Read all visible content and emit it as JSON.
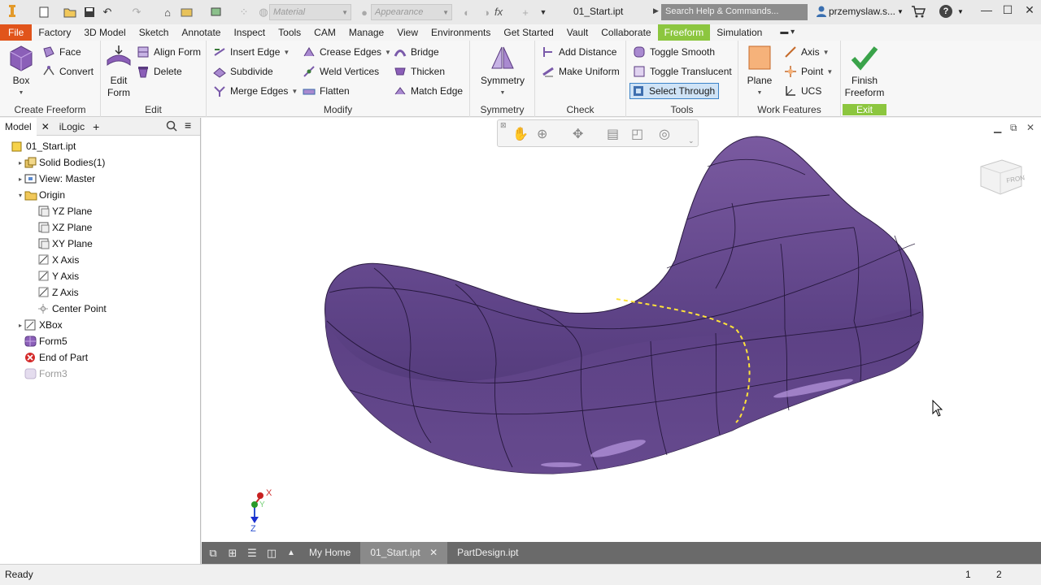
{
  "titlebar": {
    "material_placeholder": "Material",
    "appearance_placeholder": "Appearance",
    "fx_label": "fx",
    "doc_title": "01_Start.ipt",
    "search_placeholder": "Search Help & Commands...",
    "user": "przemyslaw.s..."
  },
  "menu": [
    "File",
    "Factory",
    "3D Model",
    "Sketch",
    "Annotate",
    "Inspect",
    "Tools",
    "CAM",
    "Manage",
    "View",
    "Environments",
    "Get Started",
    "Vault",
    "Collaborate",
    "Freeform",
    "Simulation"
  ],
  "menu_active": "Freeform",
  "ribbon": {
    "create_freeform": {
      "title": "Create Freeform",
      "box": "Box",
      "face": "Face",
      "convert": "Convert"
    },
    "edit": {
      "title": "Edit",
      "edit_form_1": "Edit",
      "edit_form_2": "Form",
      "align_form": "Align Form",
      "delete": "Delete"
    },
    "modify": {
      "title": "Modify",
      "insert_edge": "Insert Edge",
      "subdivide": "Subdivide",
      "merge_edges": "Merge Edges",
      "crease_edges": "Crease Edges",
      "weld_vertices": "Weld Vertices",
      "flatten": "Flatten",
      "bridge": "Bridge",
      "thicken": "Thicken",
      "match_edge": "Match Edge"
    },
    "symmetry": {
      "title": "Symmetry",
      "symmetry": "Symmetry"
    },
    "check": {
      "title": "Check",
      "add_distance": "Add Distance",
      "make_uniform": "Make Uniform"
    },
    "tools": {
      "title": "Tools",
      "toggle_smooth": "Toggle Smooth",
      "toggle_translucent": "Toggle Translucent",
      "select_through": "Select Through"
    },
    "work_features": {
      "title": "Work Features",
      "plane": "Plane",
      "axis": "Axis",
      "point": "Point",
      "ucs": "UCS"
    },
    "exit": {
      "title": "Exit",
      "finish_1": "Finish",
      "finish_2": "Freeform"
    }
  },
  "browser": {
    "tab_model": "Model",
    "tab_ilogic": "iLogic",
    "tree": [
      {
        "label": "01_Start.ipt",
        "indent": 0,
        "twisty": "",
        "icon": "part-icon"
      },
      {
        "label": "Solid Bodies(1)",
        "indent": 1,
        "twisty": "▸",
        "icon": "solid-bodies-icon"
      },
      {
        "label": "View: Master",
        "indent": 1,
        "twisty": "▸",
        "icon": "view-icon"
      },
      {
        "label": "Origin",
        "indent": 1,
        "twisty": "▾",
        "icon": "folder-icon"
      },
      {
        "label": "YZ Plane",
        "indent": 2,
        "twisty": "",
        "icon": "plane-icon"
      },
      {
        "label": "XZ Plane",
        "indent": 2,
        "twisty": "",
        "icon": "plane-icon"
      },
      {
        "label": "XY Plane",
        "indent": 2,
        "twisty": "",
        "icon": "plane-icon"
      },
      {
        "label": "X Axis",
        "indent": 2,
        "twisty": "",
        "icon": "axis-icon"
      },
      {
        "label": "Y Axis",
        "indent": 2,
        "twisty": "",
        "icon": "axis-icon"
      },
      {
        "label": "Z Axis",
        "indent": 2,
        "twisty": "",
        "icon": "axis-icon"
      },
      {
        "label": "Center Point",
        "indent": 2,
        "twisty": "",
        "icon": "point-icon"
      },
      {
        "label": "XBox",
        "indent": 1,
        "twisty": "▸",
        "icon": "xbox-icon"
      },
      {
        "label": "Form5",
        "indent": 1,
        "twisty": "",
        "icon": "form-icon"
      },
      {
        "label": "End of Part",
        "indent": 1,
        "twisty": "",
        "icon": "end-of-part-icon"
      },
      {
        "label": "Form3",
        "indent": 1,
        "twisty": "",
        "icon": "form-dim-icon"
      }
    ]
  },
  "viewport": {
    "triad_x": "X",
    "triad_y": "Y",
    "triad_z": "Z",
    "viewcube_face": "FRONT"
  },
  "doc_tabs": {
    "home": "My Home",
    "start": "01_Start.ipt",
    "partdesign": "PartDesign.ipt"
  },
  "status": {
    "text": "Ready",
    "num1": "1",
    "num2": "2"
  },
  "colors": {
    "file_menu": "#e1541b",
    "freeform_tab": "#8cc63f",
    "form_body": "#6b4c8e",
    "select_through_bg": "#cfe3f6"
  }
}
